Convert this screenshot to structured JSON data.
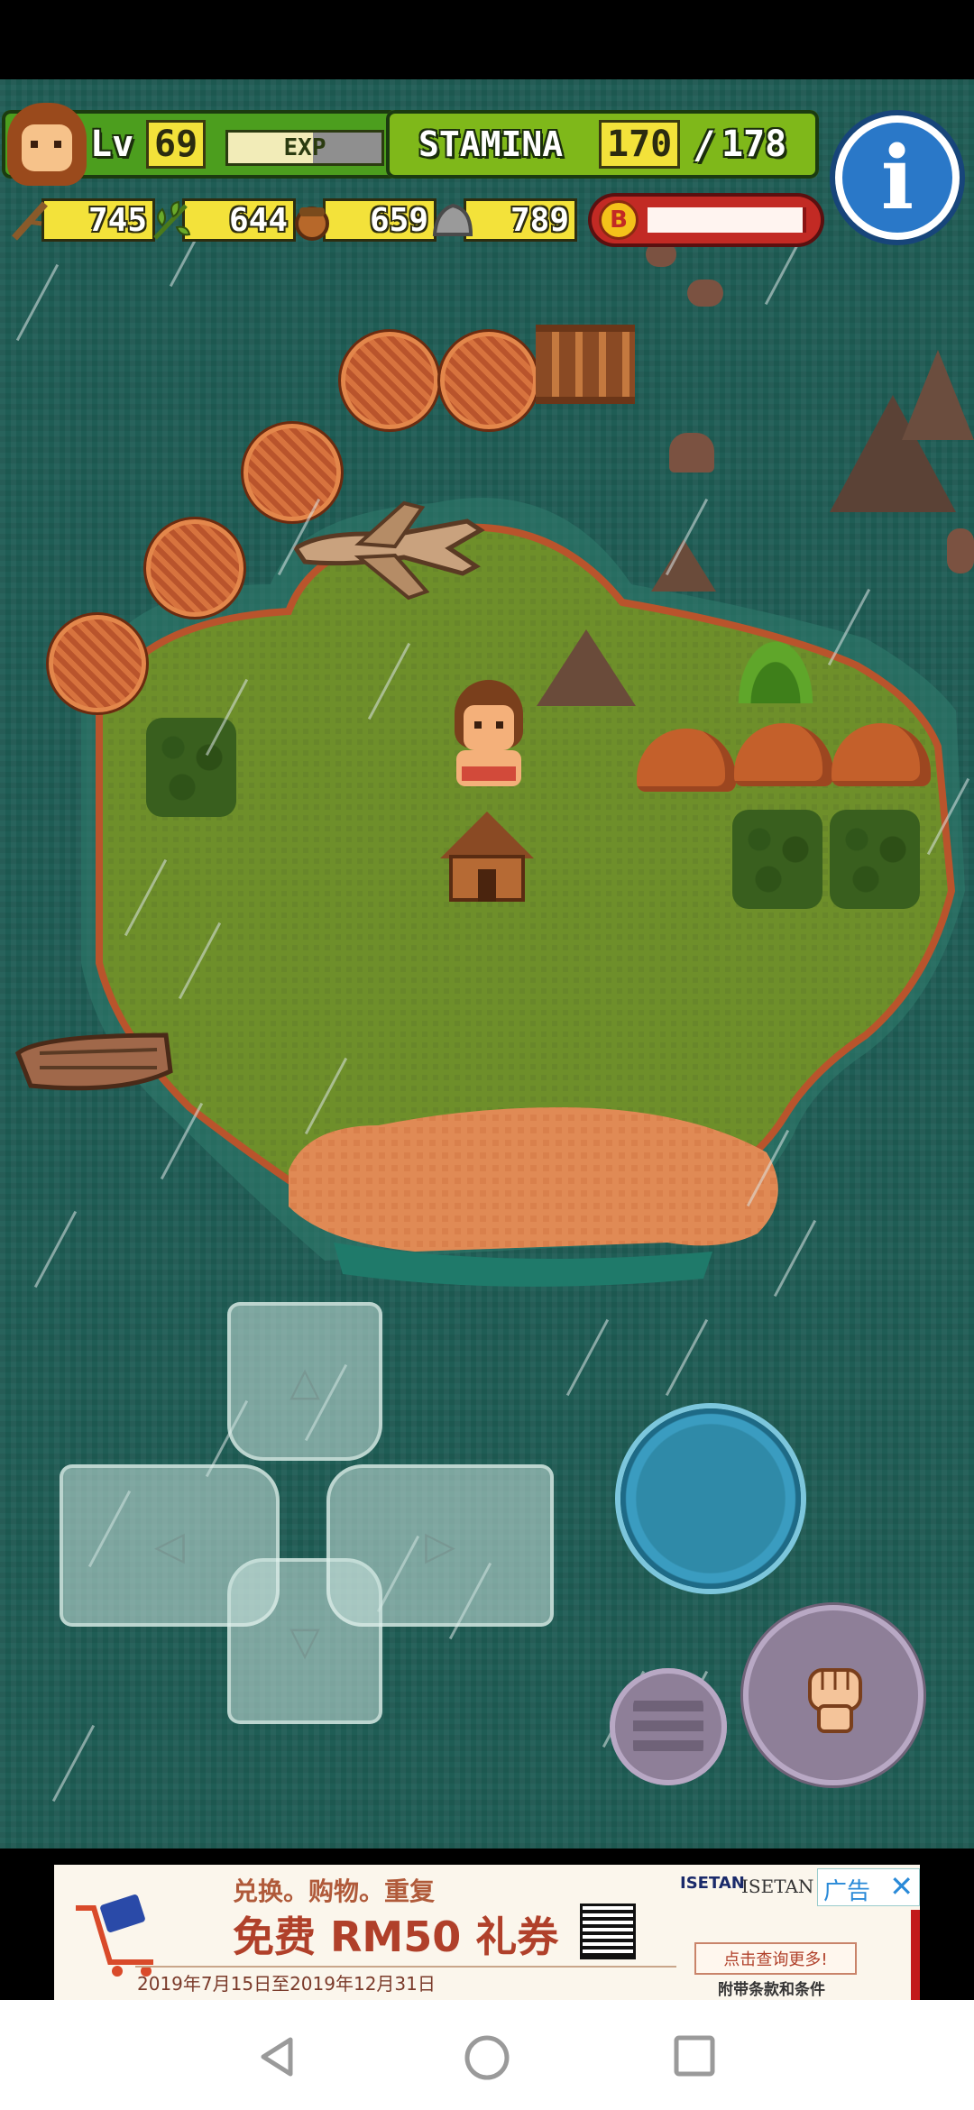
{
  "hud": {
    "level_label": "Lv",
    "level": "69",
    "exp_label": "EXP",
    "exp_fraction": 0.55,
    "stamina_label": "STAMINA",
    "stamina_current": "170",
    "stamina_sep": "/",
    "stamina_max": "178",
    "boost_label": "B",
    "boost_fraction": 0.98
  },
  "resources": {
    "wood": "745",
    "leaf": "644",
    "nut": "659",
    "stone": "789"
  },
  "ad": {
    "tagline": "兑换。购物。重复",
    "headline": "免费 RM50 礼券",
    "date_range": "2019年7月15日至2019年12月31日",
    "brand1": "ISETAN",
    "brand2": "ISETAN",
    "ad_badge": "广告",
    "cta": "点击查询更多!",
    "terms": "附带条款和条件"
  },
  "colors": {
    "ocean": "#1f5d55",
    "grass": "#6e8f2a",
    "sand": "#e08a55",
    "hud_green": "#4c9e1e",
    "hud_lime": "#7fb81a",
    "boost_red": "#c22a24"
  }
}
